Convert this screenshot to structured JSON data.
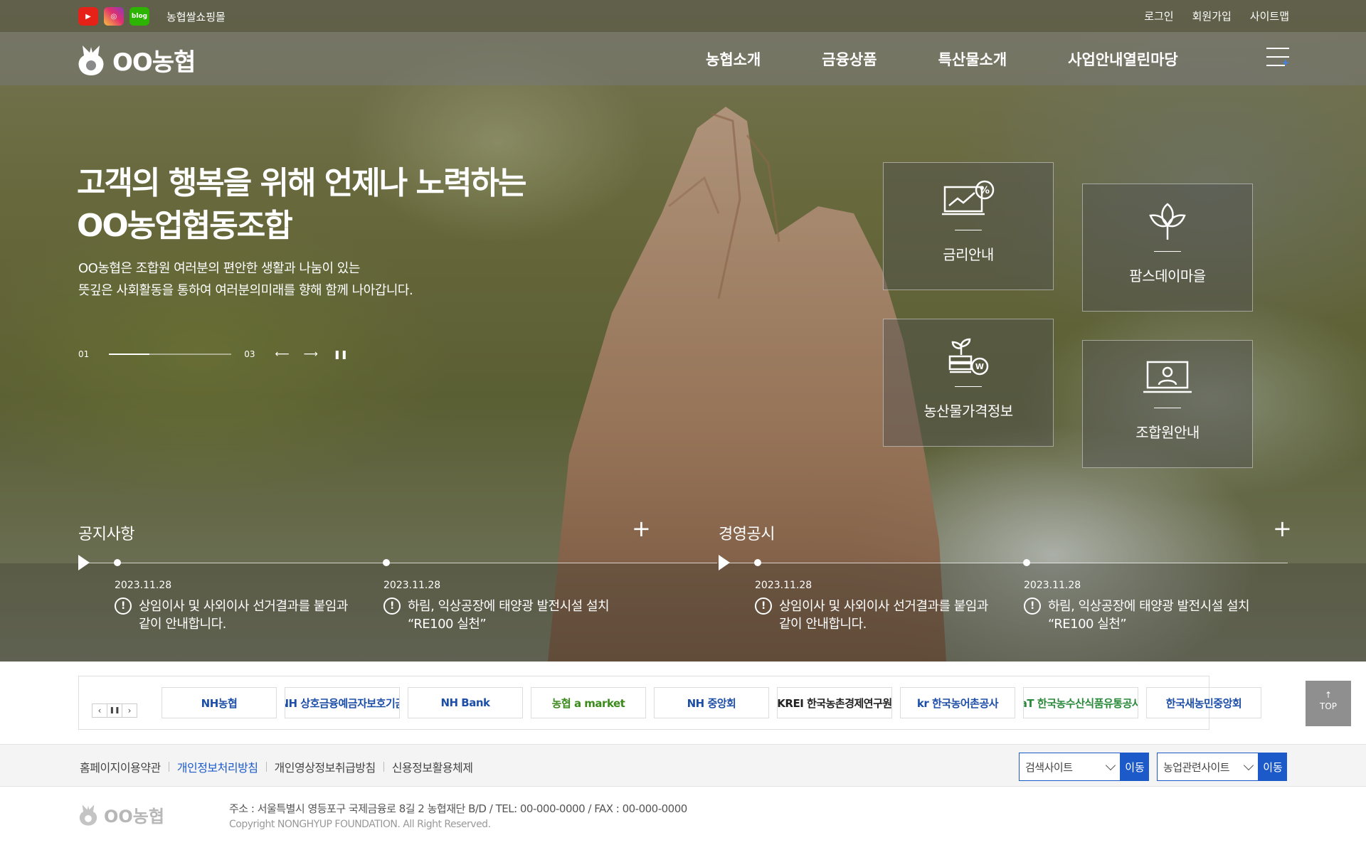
{
  "util": {
    "sns": [
      {
        "icon": "youtube-icon",
        "glyph": "▶",
        "color": "#e62117"
      },
      {
        "icon": "instagram-icon",
        "glyph": "◎",
        "color": "#e1306c"
      },
      {
        "icon": "blog-icon",
        "glyph": "blog",
        "color": "#2db400"
      }
    ],
    "mall": "농협쌀쇼핑몰",
    "links": [
      "로그인",
      "회원가입",
      "사이트맵"
    ]
  },
  "header": {
    "logo": "OO농협",
    "menu": [
      "농협소개",
      "금융상품",
      "특산물소개",
      "사업안내열린마당"
    ]
  },
  "hero": {
    "title_line1": "고객의 행복을 위해 언제나 노력하는",
    "title_line2": "OO농업협동조합",
    "desc_line1": "OO농협은 조합원 여러분의 편안한 생활과 나눔이 있는",
    "desc_line2": "뜻깊은 사회활동을 통하여 여러분의미래를 향해 함께 나아갑니다.",
    "pager": {
      "current": "01",
      "total": "03",
      "progress": 0.33
    }
  },
  "tiles": [
    {
      "label": "금리안내",
      "icon": "rate-chart-icon"
    },
    {
      "label": "팜스데이마을",
      "icon": "plant-leaf-icon"
    },
    {
      "label": "농산물가격정보",
      "icon": "sprout-price-icon"
    },
    {
      "label": "조합원안내",
      "icon": "member-monitor-icon"
    }
  ],
  "notices": [
    {
      "title": "공지사항",
      "items": [
        {
          "date": "2023.11.28",
          "line1": "상임이사 및 사외이사 선거결과를 붙임과",
          "line2": "같이 안내합니다."
        },
        {
          "date": "2023.11.28",
          "line1": "하림, 익상공장에 태양광 발전시설 설치",
          "line2": "“RE100 실천”"
        }
      ]
    },
    {
      "title": "경영공시",
      "items": [
        {
          "date": "2023.11.28",
          "line1": "상임이사 및 사외이사 선거결과를 붙임과",
          "line2": "같이 안내합니다."
        },
        {
          "date": "2023.11.28",
          "line1": "하림, 익상공장에 태양광 발전시설 설치",
          "line2": "“RE100 실천”"
        }
      ]
    }
  ],
  "partners": [
    {
      "text": "NH농협",
      "color": "#1d4fa8"
    },
    {
      "text": "NH 상호금융예금자보호기금",
      "color": "#1d4fa8"
    },
    {
      "text": "NH Bank",
      "color": "#1d4fa8"
    },
    {
      "text": "농협 a market",
      "color": "#3b8a1c"
    },
    {
      "text": "NH 중앙회",
      "color": "#1d4fa8"
    },
    {
      "text": "KREI 한국농촌경제연구원",
      "color": "#222222"
    },
    {
      "text": "kr 한국농어촌공사",
      "color": "#1d4fa8"
    },
    {
      "text": "aT 한국농수산식품유통공사",
      "color": "#2a8a3a"
    },
    {
      "text": "한국새농민중앙회",
      "color": "#1d4fa8"
    }
  ],
  "top_button": "TOP",
  "footer": {
    "links": [
      "홈페이지이용약관",
      "개인정보처리방침",
      "개인영상정보취급방침",
      "신용정보활용체제"
    ],
    "select1": "검색사이트",
    "select2": "농업관련사이트",
    "go": "이동",
    "logo": "OO농협",
    "address": "주소 : 서울특별시 영등포구 국제금융로 8길 2 농협재단 B/D / TEL: 00-000-0000 / FAX : 00-000-0000",
    "copyright": "Copyright  NONGHYUP FOUNDATION. All Right Reserved."
  }
}
